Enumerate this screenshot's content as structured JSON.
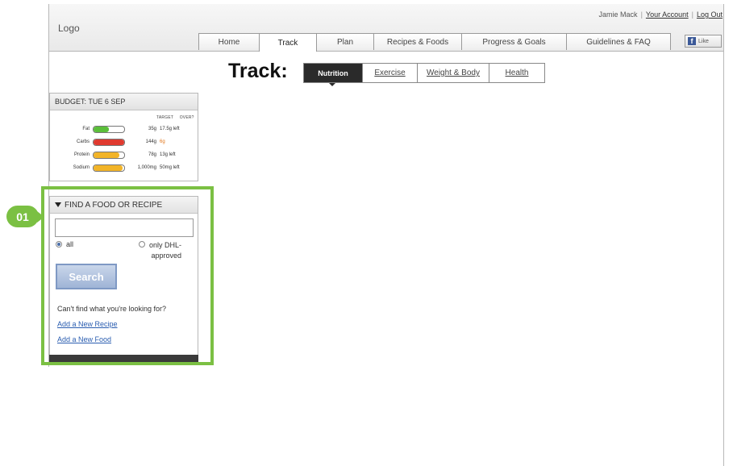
{
  "header": {
    "logo": "Logo",
    "user_name": "Jamie Mack",
    "your_account": "Your Account",
    "log_out": "Log Out",
    "like_label": "Like",
    "nav_tabs": [
      {
        "label": "Home"
      },
      {
        "label": "Track"
      },
      {
        "label": "Plan"
      },
      {
        "label": "Recipes & Foods"
      },
      {
        "label": "Progress & Goals"
      },
      {
        "label": "Guidelines & FAQ"
      }
    ],
    "active_tab": "Track"
  },
  "page": {
    "title": "Track:",
    "sub_tabs": [
      {
        "label": "Nutrition"
      },
      {
        "label": "Exercise"
      },
      {
        "label": "Weight & Body"
      },
      {
        "label": "Health"
      }
    ],
    "active_sub_tab": "Nutrition"
  },
  "budget": {
    "heading": "BUDGET: TUE 6 SEP",
    "col_target": "TARGET",
    "col_over": "OVER?",
    "rows": [
      {
        "label": "Fat",
        "target": "35g",
        "status": "17.5g left",
        "fill": 0.5,
        "color": "#5bbf3a"
      },
      {
        "label": "Carbs",
        "target": "144g",
        "status": "6g",
        "fill": 1.0,
        "color": "#e03a2f"
      },
      {
        "label": "Protein",
        "target": "78g",
        "status": "13g left",
        "fill": 0.85,
        "color": "#f2b428"
      },
      {
        "label": "Sodium",
        "target": "1,000mg",
        "status": "50mg left",
        "fill": 0.95,
        "color": "#f2b428"
      }
    ]
  },
  "find": {
    "heading": "FIND A FOOD OR RECIPE",
    "search_value": "",
    "radio_all": "all",
    "radio_approved_line1": "only DHL-",
    "radio_approved_line2": "approved",
    "search_button": "Search",
    "cant_find": "Can't find what you're looking for?",
    "add_recipe": "Add a New Recipe",
    "add_food": "Add a New Food"
  },
  "annotation": {
    "badge": "01",
    "color": "#7bc043"
  }
}
